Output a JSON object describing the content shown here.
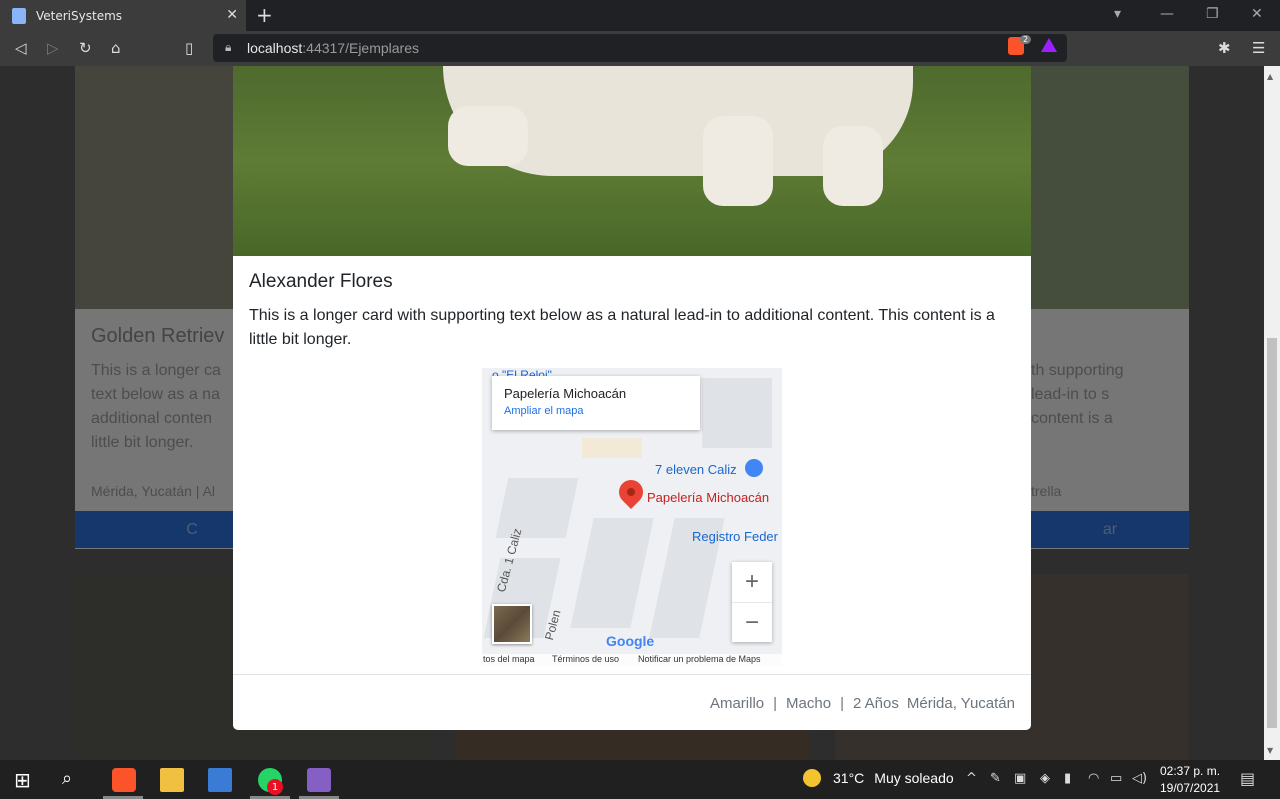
{
  "browser": {
    "tab_title": "VeteriSystems",
    "url_host": "localhost",
    "url_rest": ":44317/Ejemplares",
    "brave_shield_count": "2"
  },
  "background": {
    "card_left": {
      "title": "Golden Retriev",
      "text": "This is a longer ca text below as a na additional conten little bit longer.",
      "meta": "Mérida, Yucatán | Al",
      "button": "C"
    },
    "card_right": {
      "text": "th supporting lead-in to s content is a",
      "meta": "trella",
      "button": "ar"
    }
  },
  "modal": {
    "title": "Alexander Flores",
    "text": "This is a longer card with supporting text below as a natural lead-in to additional content. This content is a little bit longer.",
    "map": {
      "place_name": "Papelería Michoacán",
      "expand_link": "Ampliar el mapa",
      "pin_label": "Papelería Michoacán",
      "poi_1": "7 eleven Caliz",
      "poi_2": "Registro Feder",
      "top_label": "o \"El Reloj\"",
      "street_1": "Cda. 1 Caliz",
      "street_2": "Polen",
      "logo": "Google",
      "footer_data": "tos del mapa",
      "footer_terms": "Términos de uso",
      "footer_report": "Notificar un problema de Maps",
      "zoom_in": "+",
      "zoom_out": "−"
    },
    "footer": {
      "color": "Amarillo",
      "sex": "Macho",
      "age": "2 Años",
      "location": "Mérida, Yucatán",
      "separator": "|"
    }
  },
  "taskbar": {
    "weather_temp": "31°C",
    "weather_desc": "Muy soleado",
    "time": "02:37 p. m.",
    "date": "19/07/2021",
    "whatsapp_badge": "1"
  },
  "colors": {
    "primary_button": "#2a6fd6",
    "pin": "#ea4335",
    "link": "#1a73e8"
  }
}
